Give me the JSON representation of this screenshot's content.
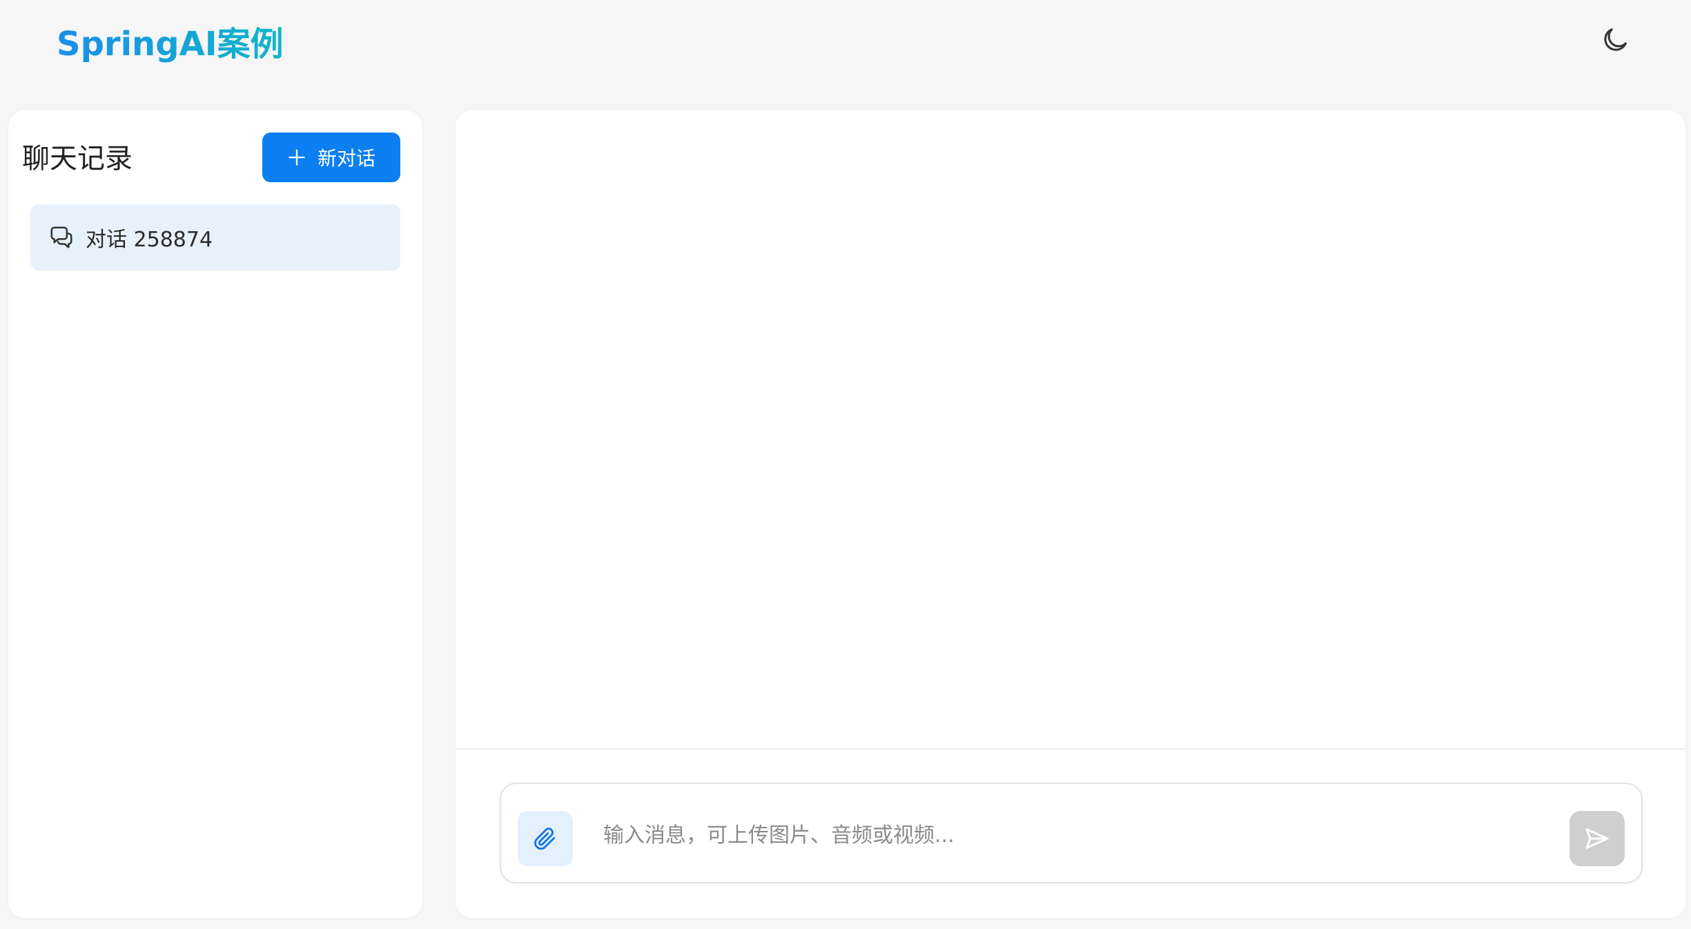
{
  "header": {
    "brand": "SpringAI案例",
    "theme_icon": "moon-icon"
  },
  "sidebar": {
    "title": "聊天记录",
    "new_chat_label": "新对话",
    "new_chat_icon": "plus-icon",
    "conversations": [
      {
        "label": "对话 258874",
        "icon": "chat-bubbles-icon",
        "active": true
      }
    ]
  },
  "composer": {
    "placeholder": "输入消息，可上传图片、音频或视频...",
    "value": "",
    "attach_icon": "paperclip-icon",
    "send_icon": "send-icon"
  },
  "colors": {
    "accent": "#0c7ff2",
    "brand_gradient_start": "#1a8fe8",
    "brand_gradient_end": "#13b6c8",
    "active_item_bg": "#e7f1fc",
    "send_disabled_bg": "#cfcfcf"
  }
}
